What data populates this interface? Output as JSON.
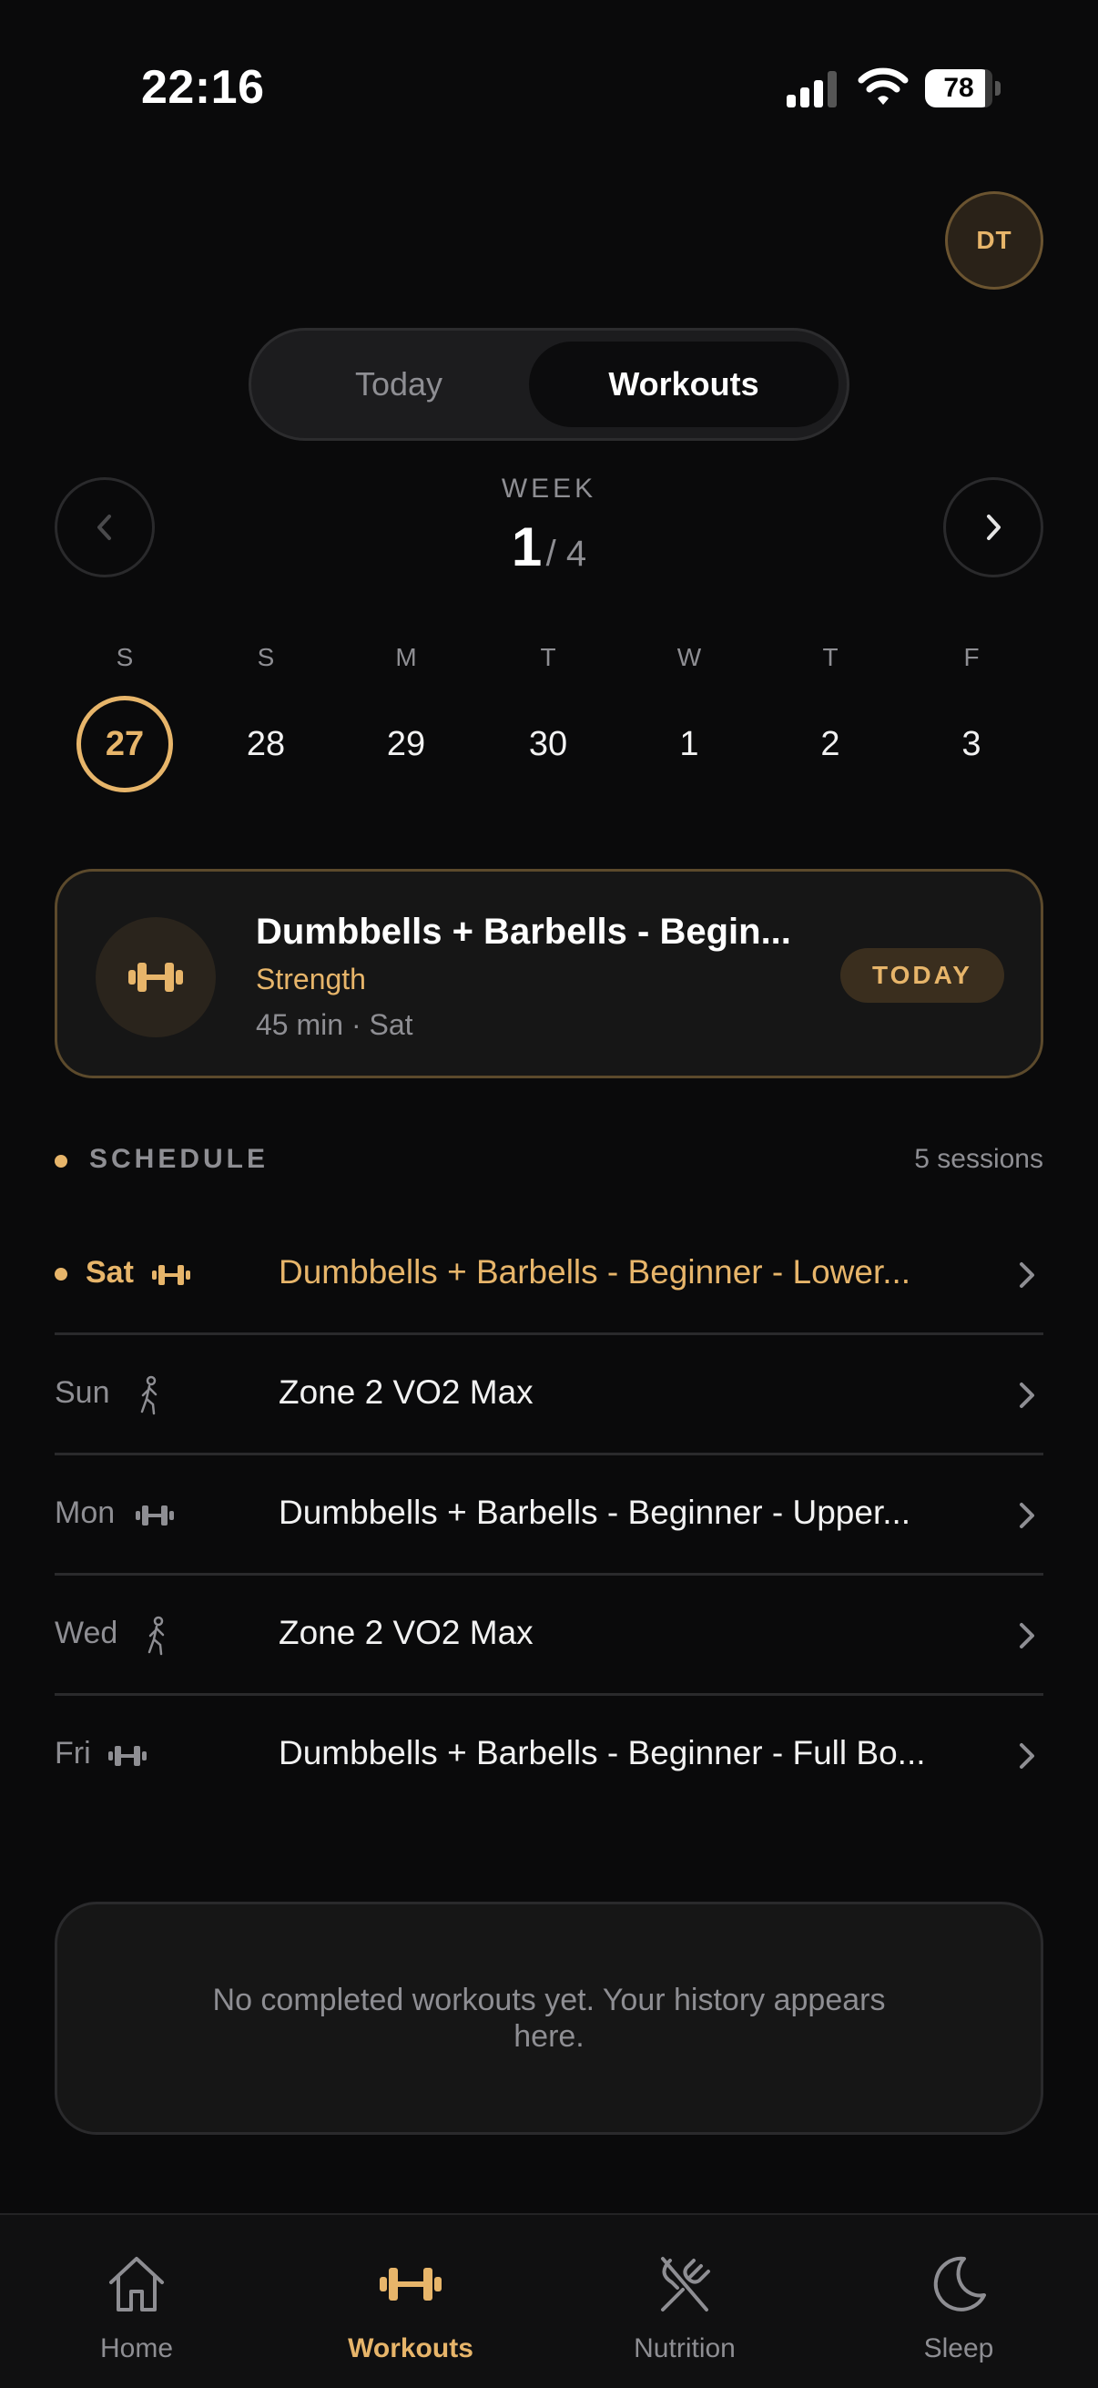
{
  "status_bar": {
    "time": "22:16",
    "battery": "78"
  },
  "header": {
    "avatar_initials": "DT"
  },
  "segmented_control": {
    "options": [
      "Today",
      "Workouts"
    ],
    "selected": "Workouts"
  },
  "week": {
    "label": "WEEK",
    "current": "1",
    "total": "/ 4"
  },
  "days": [
    {
      "letter": "S",
      "number": "27",
      "selected": true
    },
    {
      "letter": "S",
      "number": "28"
    },
    {
      "letter": "M",
      "number": "29"
    },
    {
      "letter": "T",
      "number": "30"
    },
    {
      "letter": "W",
      "number": "1"
    },
    {
      "letter": "T",
      "number": "2"
    },
    {
      "letter": "F",
      "number": "3"
    }
  ],
  "featured_workout": {
    "title": "Dumbbells + Barbells - Begin...",
    "category": "Strength",
    "meta": "45 min · Sat",
    "badge": "TODAY",
    "icon": "dumbbell-icon"
  },
  "schedule": {
    "title": "SCHEDULE",
    "count": "5 sessions",
    "rows": [
      {
        "day": "Sat",
        "icon": "dumbbell-icon",
        "name": "Dumbbells + Barbells - Beginner - Lower...",
        "active": true
      },
      {
        "day": "Sun",
        "icon": "walking-icon",
        "name": "Zone 2 VO2 Max"
      },
      {
        "day": "Mon",
        "icon": "dumbbell-icon",
        "name": "Dumbbells + Barbells - Beginner - Upper..."
      },
      {
        "day": "Wed",
        "icon": "walking-icon",
        "name": "Zone 2 VO2 Max"
      },
      {
        "day": "Fri",
        "icon": "dumbbell-icon",
        "name": "Dumbbells + Barbells - Beginner - Full Bo..."
      }
    ]
  },
  "history": {
    "empty_text": "No completed workouts yet. Your history appears here."
  },
  "tab_bar": {
    "tabs": [
      {
        "label": "Home",
        "icon": "home-icon"
      },
      {
        "label": "Workouts",
        "icon": "dumbbell-icon",
        "active": true
      },
      {
        "label": "Nutrition",
        "icon": "fork-knife-icon"
      },
      {
        "label": "Sleep",
        "icon": "moon-icon"
      }
    ]
  },
  "colors": {
    "accent": "#e7b56a",
    "background": "#0a0a0b",
    "card": "#161616",
    "muted": "#8e8e93"
  }
}
